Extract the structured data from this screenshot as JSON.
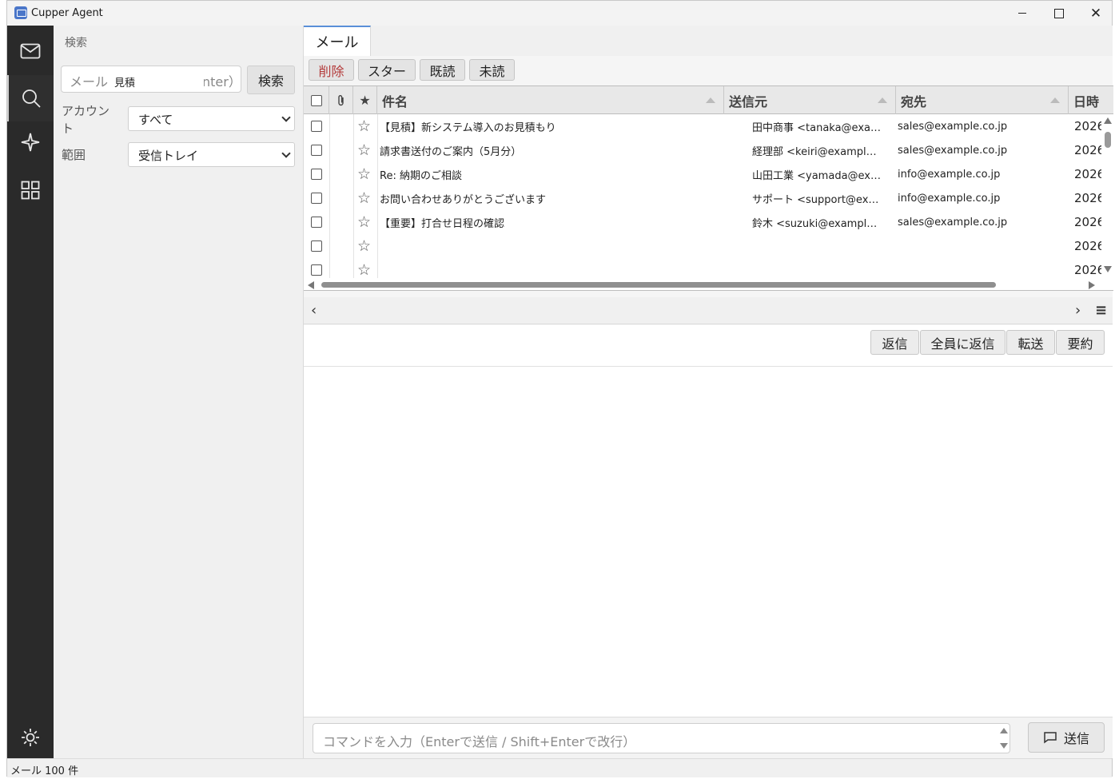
{
  "window": {
    "title": "Cupper Agent"
  },
  "rail": {
    "items": [
      "mail-icon",
      "search-icon",
      "sparkle-icon",
      "apps-grid-icon"
    ],
    "bottom": "settings-gear-icon"
  },
  "search_panel": {
    "header": "検索",
    "search_input": {
      "placeholder_visible": "メール",
      "value": "見積",
      "placeholder_tail": "nter）"
    },
    "search_button": "検索",
    "account_label": "アカウント",
    "account_value": "すべて",
    "scope_label": "範囲",
    "scope_value": "受信トレイ"
  },
  "main": {
    "tab": "メール",
    "toolbar": {
      "delete": "削除",
      "star": "スター",
      "read": "既読",
      "unread": "未読"
    },
    "columns": {
      "attachment": "📎",
      "star": "★",
      "subject": "件名",
      "from": "送信元",
      "to": "宛先",
      "date": "日時"
    },
    "rows": [
      {
        "subject": "【見積】新システム導入のお見積もり",
        "from": "田中商事 <tanaka@exa…",
        "to": "sales@example.co.jp",
        "date": "2026"
      },
      {
        "subject": "請求書送付のご案内（5月分）",
        "from": "経理部 <keiri@exampl…",
        "to": "sales@example.co.jp",
        "date": "2026"
      },
      {
        "subject": "Re: 納期のご相談",
        "from": "山田工業 <yamada@ex…",
        "to": "info@example.co.jp",
        "date": "2026"
      },
      {
        "subject": "お問い合わせありがとうございます",
        "from": "サポート <support@ex…",
        "to": "info@example.co.jp",
        "date": "2026"
      },
      {
        "subject": "【重要】打合せ日程の確認",
        "from": "鈴木 <suzuki@exampl…",
        "to": "sales@example.co.jp",
        "date": "2026"
      },
      {
        "subject": "",
        "from": "",
        "to": "",
        "date": "2026"
      },
      {
        "subject": "",
        "from": "",
        "to": "",
        "date": "2026"
      }
    ],
    "star_glyph": "☆",
    "pager": {
      "prev": "‹",
      "next": "›",
      "menu": "≡"
    },
    "actions": {
      "reply": "返信",
      "reply_all": "全員に返信",
      "forward": "転送",
      "summarize": "要約"
    },
    "command": {
      "placeholder": "コマンドを入力（Enterで送信 / Shift+Enterで改行）",
      "send": "送信"
    }
  },
  "status": {
    "text": "メール 100 件"
  },
  "colors": {
    "rail_bg": "#2a2a2a",
    "accent_tab": "#5a8fd8",
    "danger": "#b33a3a"
  }
}
